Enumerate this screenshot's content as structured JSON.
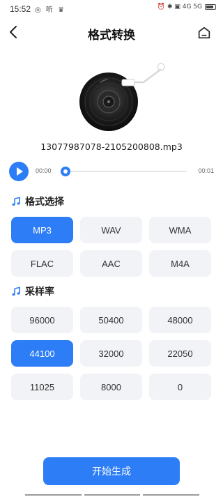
{
  "status_bar": {
    "time": "15:52",
    "left_icons": "◎ 听 ♛",
    "right_icons": "⏰ ✱ ▣ 4G 5G"
  },
  "nav": {
    "title": "格式转换"
  },
  "file": {
    "name": "13077987078-2105200808.mp3"
  },
  "player": {
    "current_time": "00:00",
    "total_time": "00:01",
    "progress": 0
  },
  "format_section": {
    "title": "格式选择",
    "options": [
      "MP3",
      "WAV",
      "WMA",
      "FLAC",
      "AAC",
      "M4A"
    ],
    "selected": "MP3"
  },
  "rate_section": {
    "title": "采样率",
    "options": [
      "96000",
      "50400",
      "48000",
      "44100",
      "32000",
      "22050",
      "11025",
      "8000",
      "0"
    ],
    "selected": "44100"
  },
  "start_button": {
    "label": "开始生成"
  },
  "colors": {
    "accent": "#2d7df6",
    "chip_bg": "#f2f3f7"
  }
}
